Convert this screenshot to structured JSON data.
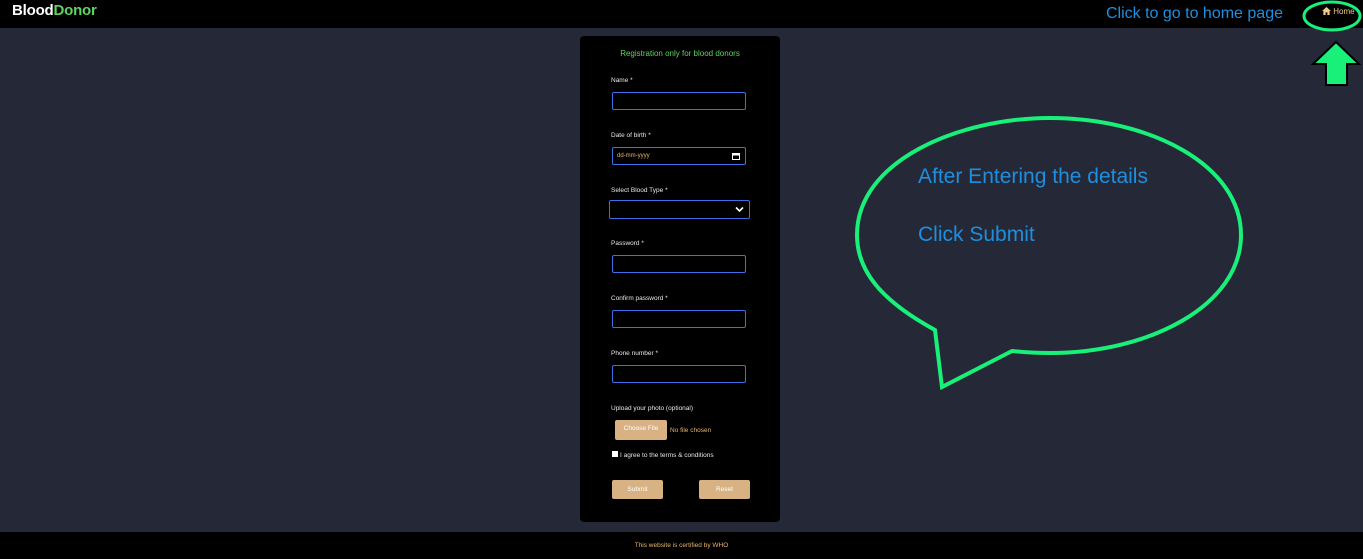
{
  "header": {
    "brand_part1": "Blood",
    "brand_part2": "Donor",
    "home_label": "Home"
  },
  "annotations": {
    "home_hint": "Click to go to home page",
    "bubble_line1": "After Entering the details",
    "bubble_line2": "Click Submit"
  },
  "form": {
    "title": "Registration only for blood donors",
    "name_label": "Name *",
    "dob_label": "Date of birth *",
    "dob_placeholder": "dd-mm-yyyy",
    "blood_type_label": "Select Blood Type *",
    "password_label": "Password *",
    "confirm_password_label": "Confirm password *",
    "phone_label": "Phone number *",
    "photo_label": "Upload your photo (optional)",
    "choose_file_label": "Choose File",
    "no_file_text": "No file chosen",
    "terms_label": "I agree to the terms & conditions",
    "submit_label": "Submit",
    "reset_label": "Reset"
  },
  "footer": {
    "text": "This website is certified by WHO"
  },
  "colors": {
    "background": "#252836",
    "bar": "#000000",
    "brand_green": "#5fd35f",
    "accent_tan": "#d8b282",
    "input_border": "#3e6ee8",
    "annotation_green": "#19f07a",
    "annotation_blue": "#1e8fe0"
  },
  "icons": {
    "home": "home-icon",
    "calendar": "calendar-icon",
    "dropdown": "chevron-down-icon",
    "arrow": "arrow-up-icon"
  }
}
